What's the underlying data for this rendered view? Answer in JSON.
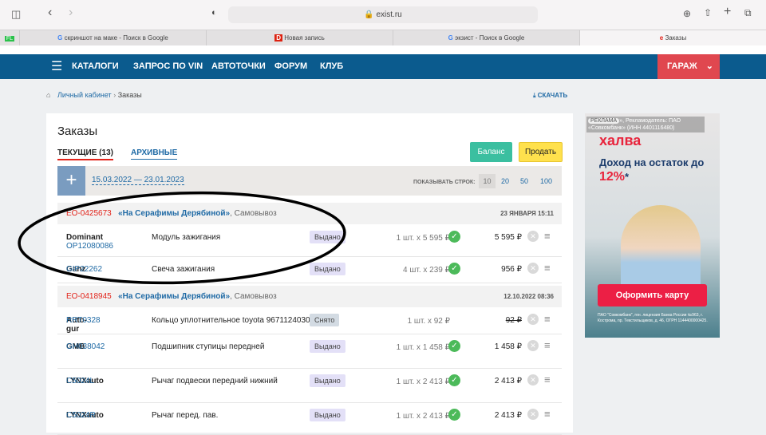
{
  "browser": {
    "url": "exist.ru",
    "tabs": [
      {
        "label": "скриншот на маке - Поиск в Google"
      },
      {
        "label": "Новая запись"
      },
      {
        "label": "экзист - Поиск в Google"
      },
      {
        "label": "Заказы"
      }
    ]
  },
  "nav": {
    "items": [
      "КАТАЛОГИ",
      "ЗАПРОС ПО VIN",
      "АВТОТОЧКИ",
      "ФОРУМ",
      "КЛУБ"
    ],
    "garage": "ГАРАЖ"
  },
  "breadcrumb": {
    "home": "Личный кабинет",
    "current": "Заказы",
    "download": "СКАЧАТЬ"
  },
  "page": {
    "title": "Заказы",
    "tab_current": "ТЕКУЩИЕ (13)",
    "tab_archive": "АРХИВНЫЕ",
    "balance": "Баланс",
    "sell": "Продать",
    "date_range": "15.03.2022 — 23.01.2023",
    "rows_label": "ПОКАЗЫВАТЬ СТРОК:",
    "rows_options": [
      "10",
      "20",
      "50",
      "100"
    ]
  },
  "orders": [
    {
      "number": "EO-0425673",
      "shop": "«На Серафимы Дерябиной»",
      "delivery": ", Самовывоз",
      "date": "23 ЯНВАРЯ 15:11",
      "items": [
        {
          "brand": "Dominant",
          "code": "OP12080086",
          "name": "Модуль зажигания",
          "status": "Выдано",
          "qty": "1 шт. x 5 595 ₽",
          "price": "5 595 ₽"
        },
        {
          "brand": "Ganz",
          "code": "GIP22262",
          "name": "Свеча зажигания",
          "status": "Выдано",
          "qty": "4 шт. x 239 ₽",
          "price": "956 ₽"
        }
      ]
    },
    {
      "number": "EO-0418945",
      "shop": "«На Серафимы Дерябиной»",
      "delivery": ", Самовывоз",
      "date": "12.10.2022 08:36",
      "items": [
        {
          "brand": "Auto-gur",
          "code": "RRT0328",
          "name": "Кольцо уплотнительное toyota 9671124030",
          "status": "Снято",
          "qty": "1 шт. x 92 ₽",
          "price": "92 ₽"
        },
        {
          "brand": "GMB",
          "code": "GH038042",
          "name": "Подшипник ступицы передней",
          "status": "Выдано",
          "qty": "1 шт. x 1 458 ₽",
          "price": "1 458 ₽"
        },
        {
          "brand": "LYNXauto",
          "code": "C5024L",
          "name": "Рычаг подвески передний нижний",
          "status": "Выдано",
          "qty": "1 шт. x 2 413 ₽",
          "price": "2 413 ₽"
        },
        {
          "brand": "LYNXauto",
          "code": "C5024R",
          "name": "Рычаг перед. пав.",
          "status": "Выдано",
          "qty": "1 шт. x 2 413 ₽",
          "price": "2 413 ₽"
        }
      ]
    }
  ],
  "ad": {
    "label": "РЕКЛАМА",
    "advertiser": "», Рекламодатель: ПАО «Совкомбанк» (ИНН 4401116480)",
    "brand": "халва",
    "headline": "Доход на остаток до",
    "rate": "12%",
    "cta": "Оформить карту",
    "legal": "ПАО \"Совкомбанк\", ген. лицензия Банка России №963, г. Кострома, пр. Текстильщиков, д. 46, ОГРН 1144400000425."
  }
}
